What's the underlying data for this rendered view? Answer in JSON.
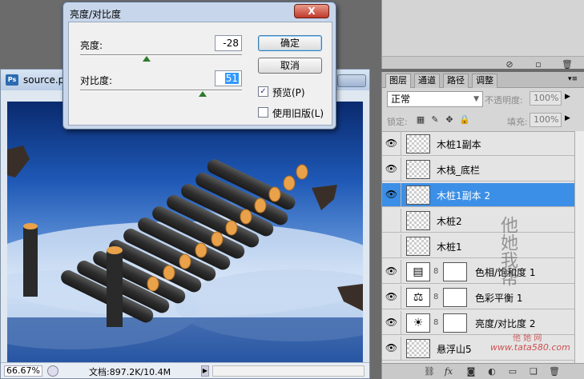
{
  "dialog": {
    "title": "亮度/对比度",
    "close_glyph": "X",
    "brightness_label": "亮度:",
    "brightness_value": "-28",
    "contrast_label": "对比度:",
    "contrast_value": "51",
    "ok_label": "确定",
    "cancel_label": "取消",
    "preview_label": "预览(P)",
    "preview_checked": true,
    "legacy_label": "使用旧版(L)",
    "legacy_checked": false
  },
  "document": {
    "ps_logo": "Ps",
    "title": "source.ps",
    "zoom": "66.67%",
    "doc_info": "文档:897.2K/10.4M",
    "arrow_glyph": "▶"
  },
  "layers_panel": {
    "tabs": [
      "图层",
      "通道",
      "路径",
      "调整"
    ],
    "blend_mode": "正常",
    "opacity_label": "不透明度:",
    "opacity_value": "100%",
    "lock_label": "锁定:",
    "fill_label": "填充:",
    "fill_value": "100%",
    "layers": [
      {
        "name": "木桩1副本",
        "visible": true,
        "selected": false,
        "kind": "pixel"
      },
      {
        "name": "木栈_底栏",
        "visible": true,
        "selected": false,
        "kind": "pixel"
      },
      {
        "name": "木桩1副本 2",
        "visible": true,
        "selected": true,
        "kind": "pixel"
      },
      {
        "name": "木桩2",
        "visible": false,
        "selected": false,
        "kind": "pixel"
      },
      {
        "name": "木桩1",
        "visible": false,
        "selected": false,
        "kind": "pixel"
      },
      {
        "name": "色相/饱和度 1",
        "visible": true,
        "selected": false,
        "kind": "adjustment",
        "icon": "gradient-icon"
      },
      {
        "name": "色彩平衡 1",
        "visible": true,
        "selected": false,
        "kind": "adjustment",
        "icon": "balance-icon"
      },
      {
        "name": "亮度/对比度 2",
        "visible": true,
        "selected": false,
        "kind": "adjustment",
        "icon": "sun-icon"
      },
      {
        "name": "悬浮山5",
        "visible": true,
        "selected": false,
        "kind": "pixel"
      }
    ]
  },
  "watermark": {
    "seal": "他她我帮",
    "site": "www.tata580.com",
    "sub": "他 她 网"
  },
  "colors": {
    "selection": "#3b8fe6",
    "dialog_frame": "#c7d6ea",
    "close_button": "#c0392b"
  }
}
